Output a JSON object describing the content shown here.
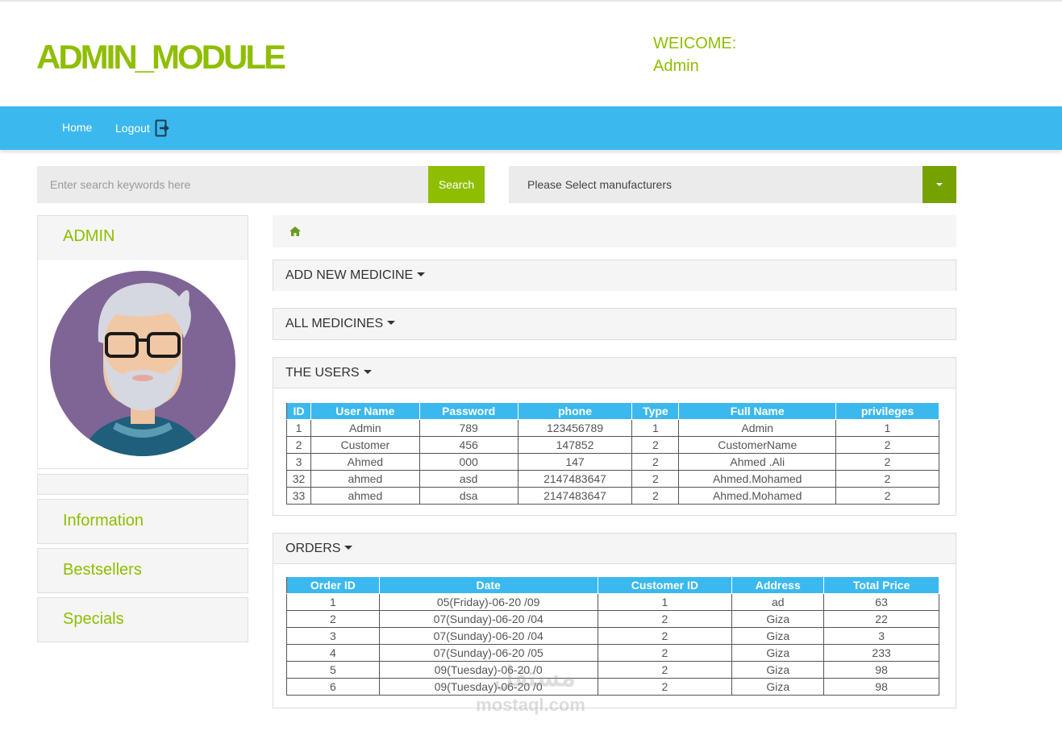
{
  "header": {
    "logo": "ADMIN_MODULE",
    "welcome_label": "WEICOME:",
    "welcome_user": "Admin"
  },
  "nav": {
    "home": "Home",
    "logout": "Logout"
  },
  "search": {
    "placeholder": "Enter search keywords here",
    "button": "Search",
    "manufacturer_select": "Please Select manufacturers"
  },
  "sidebar": {
    "title": "ADMIN",
    "links": [
      "Information",
      "Bestsellers",
      "Specials"
    ]
  },
  "panels": {
    "add_medicine": "ADD NEW MEDICINE",
    "all_medicines": "ALL MEDICINES",
    "users": "THE USERS",
    "orders": "ORDERS"
  },
  "users_table": {
    "columns": [
      "ID",
      "User Name",
      "Password",
      "phone",
      "Type",
      "Full Name",
      "privileges"
    ],
    "rows": [
      [
        "1",
        "Admin",
        "789",
        "123456789",
        "1",
        "Admin",
        "1"
      ],
      [
        "2",
        "Customer",
        "456",
        "147852",
        "2",
        "CustomerName",
        "2"
      ],
      [
        "3",
        "Ahmed",
        "000",
        "147",
        "2",
        "Ahmed .Ali",
        "2"
      ],
      [
        "32",
        "ahmed",
        "asd",
        "2147483647",
        "2",
        "Ahmed.Mohamed",
        "2"
      ],
      [
        "33",
        "ahmed",
        "dsa",
        "2147483647",
        "2",
        "Ahmed.Mohamed",
        "2"
      ]
    ]
  },
  "orders_table": {
    "columns": [
      "Order ID",
      "Date",
      "Customer ID",
      "Address",
      "Total Price"
    ],
    "rows": [
      [
        "1",
        "05(Friday)-06-20 /09",
        "1",
        "ad",
        "63"
      ],
      [
        "2",
        "07(Sunday)-06-20 /04",
        "2",
        "Giza",
        "22"
      ],
      [
        "3",
        "07(Sunday)-06-20 /04",
        "2",
        "Giza",
        "3"
      ],
      [
        "4",
        "07(Sunday)-06-20 /05",
        "2",
        "Giza",
        "233"
      ],
      [
        "5",
        "09(Tuesday)-06-20 /0",
        "2",
        "Giza",
        "98"
      ],
      [
        "6",
        "09(Tuesday)-06-20 /0",
        "2",
        "Giza",
        "98"
      ]
    ]
  },
  "watermark": {
    "arabic": "مستقل",
    "latin": "mostaql.com"
  },
  "colors": {
    "brand_green": "#8fbe00",
    "nav_blue": "#3bb9ee",
    "dark_green": "#75a200"
  },
  "icons": [
    "logout-icon",
    "home-icon",
    "caret-down-icon",
    "avatar-illustration"
  ]
}
